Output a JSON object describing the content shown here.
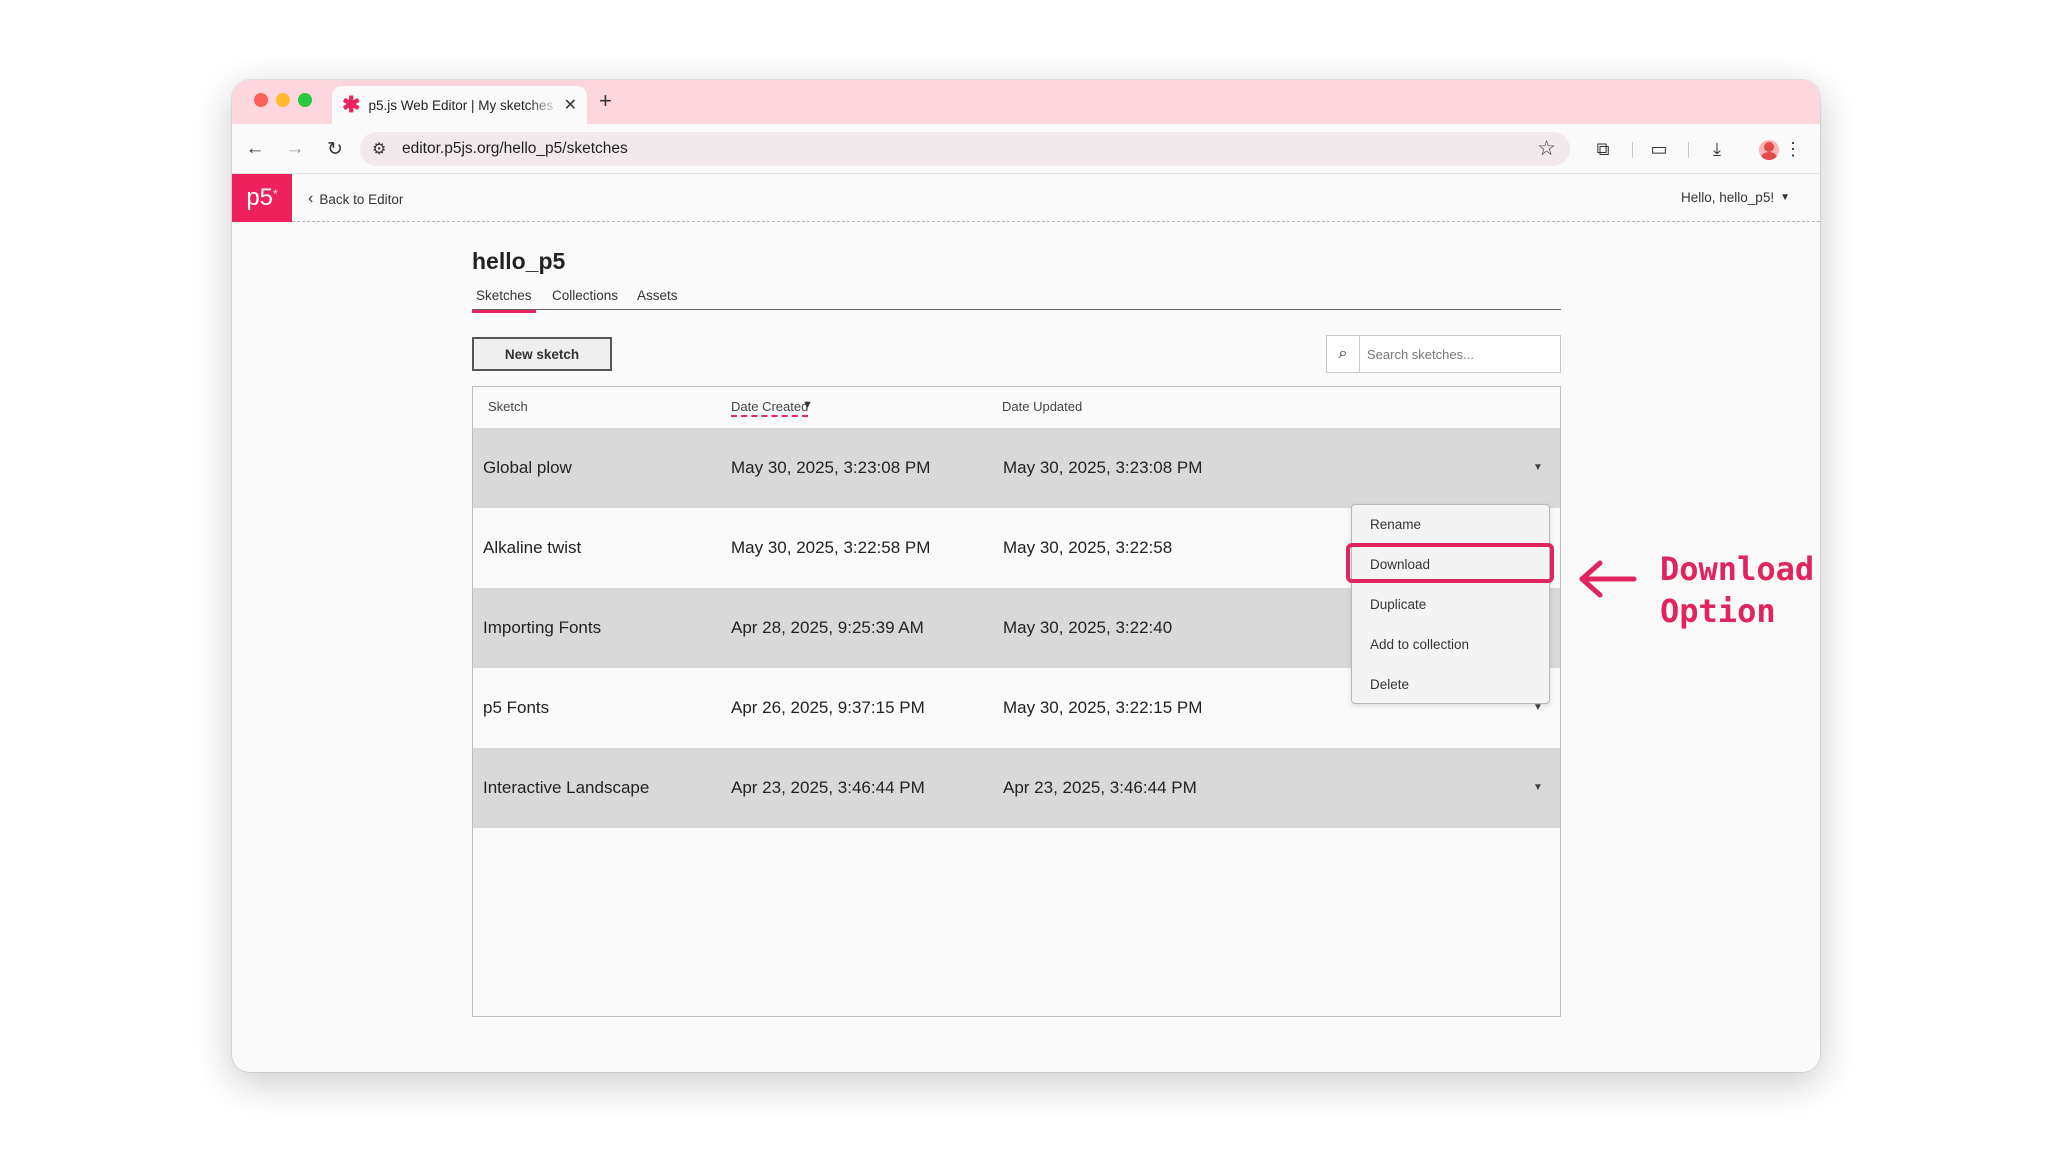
{
  "browser": {
    "tab_title": "p5.js Web Editor | My sketches",
    "url": "editor.p5js.org/hello_p5/sketches"
  },
  "nav": {
    "logo": "p5",
    "logo_sup": "*",
    "back_label": "Back to Editor",
    "user_greeting": "Hello, hello_p5!"
  },
  "owner": "hello_p5",
  "tabs": [
    "Sketches",
    "Collections",
    "Assets"
  ],
  "actions": {
    "new_sketch": "New sketch",
    "search_placeholder": "Search sketches..."
  },
  "table": {
    "columns": [
      "Sketch",
      "Date Created",
      "Date Updated"
    ],
    "rows": [
      {
        "name": "Global plow",
        "created": "May 30, 2025, 3:23:08 PM",
        "updated": "May 30, 2025, 3:23:08 PM"
      },
      {
        "name": "Alkaline twist",
        "created": "May 30, 2025, 3:22:58 PM",
        "updated": "May 30, 2025, 3:22:58"
      },
      {
        "name": "Importing Fonts",
        "created": "Apr 28, 2025, 9:25:39 AM",
        "updated": "May 30, 2025, 3:22:40"
      },
      {
        "name": "p5 Fonts",
        "created": "Apr 26, 2025, 9:37:15 PM",
        "updated": "May 30, 2025, 3:22:15 PM"
      },
      {
        "name": "Interactive Landscape",
        "created": "Apr 23, 2025, 3:46:44 PM",
        "updated": "Apr 23, 2025, 3:46:44 PM"
      }
    ]
  },
  "menu": [
    "Rename",
    "Download",
    "Duplicate",
    "Add to collection",
    "Delete"
  ],
  "annotation": [
    "Download",
    "Option"
  ],
  "colors": {
    "accent": "#ed225d",
    "annotation": "#e0245e",
    "tabstrip": "#fdd6de"
  }
}
